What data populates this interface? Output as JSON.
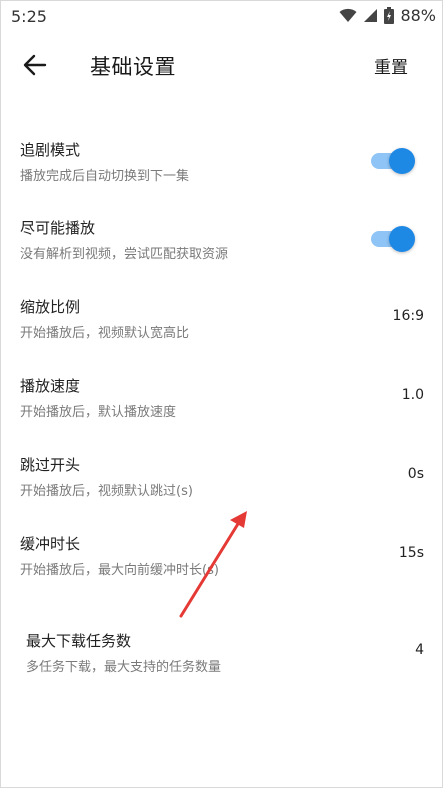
{
  "status_bar": {
    "time": "5:25",
    "battery": "88%",
    "icons": [
      "wifi-icon",
      "signal-icon",
      "battery-icon"
    ]
  },
  "app_bar": {
    "title": "基础设置",
    "reset_label": "重置",
    "back_icon": "back-arrow-icon"
  },
  "colors": {
    "toggle_thumb": "#1e88e5",
    "toggle_track": "#8fc4f6",
    "annotation": "#e53935"
  },
  "settings": [
    {
      "title": "追剧模式",
      "desc": "播放完成后自动切换到下一集",
      "toggle_on": true
    },
    {
      "title": "尽可能播放",
      "desc": "没有解析到视频，尝试匹配获取资源",
      "toggle_on": true
    },
    {
      "title": "缩放比例",
      "desc": "开始播放后，视频默认宽高比",
      "value": "16:9"
    },
    {
      "title": "播放速度",
      "desc": "开始播放后，默认播放速度",
      "value": "1.0"
    },
    {
      "title": "跳过开头",
      "desc": "开始播放后，视频默认跳过(s)",
      "value": "0s"
    },
    {
      "title": "缓冲时长",
      "desc": "开始播放后，最大向前缓冲时长(s)",
      "value": "15s"
    },
    {
      "title": "最大下载任务数",
      "desc": "多任务下载，最大支持的任务数量",
      "value": "4"
    }
  ]
}
